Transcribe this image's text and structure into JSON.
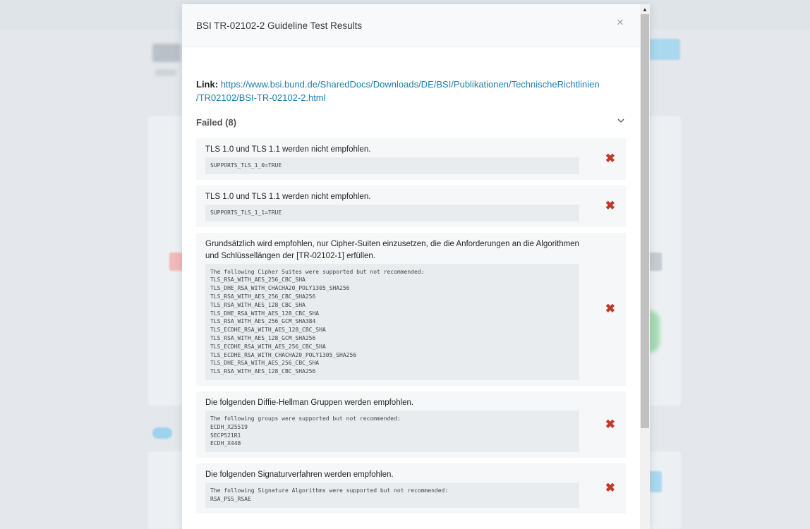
{
  "modal": {
    "title": "BSI TR-02102-2 Guideline Test Results",
    "close": "×",
    "link_label": "Link:",
    "link_url": "https://www.bsi.bund.de/SharedDocs/Downloads/DE/BSI/Publikationen/TechnischeRichtlinien/TR02102/BSI-TR-02102-2.html",
    "link_line1": "https://www.bsi.bund.de/SharedDocs/Downloads/DE/BSI/Publikationen/TechnischeRichtlinien",
    "link_line2": "/TR02102/BSI-TR-02102-2.html"
  },
  "failed_section": {
    "label": "Failed (8)",
    "rows": [
      {
        "text": "TLS 1.0 und TLS 1.1 werden nicht empfohlen.",
        "code": "SUPPORTS_TLS_1_0=TRUE"
      },
      {
        "text": "TLS 1.0 und TLS 1.1 werden nicht empfohlen.",
        "code": "SUPPORTS_TLS_1_1=TRUE"
      },
      {
        "text": "Grundsätzlich wird empfohlen, nur Cipher-Suiten einzusetzen, die die Anforderungen an die Algorithmen und Schlüssellängen der [TR-02102-1] erfüllen.",
        "code": "The following Cipher Suites were supported but not recommended:\nTLS_RSA_WITH_AES_256_CBC_SHA\nTLS_DHE_RSA_WITH_CHACHA20_POLY1305_SHA256\nTLS_RSA_WITH_AES_256_CBC_SHA256\nTLS_RSA_WITH_AES_128_CBC_SHA\nTLS_DHE_RSA_WITH_AES_128_CBC_SHA\nTLS_RSA_WITH_AES_256_GCM_SHA384\nTLS_ECDHE_RSA_WITH_AES_128_CBC_SHA\nTLS_RSA_WITH_AES_128_GCM_SHA256\nTLS_ECDHE_RSA_WITH_AES_256_CBC_SHA\nTLS_ECDHE_RSA_WITH_CHACHA20_POLY1305_SHA256\nTLS_DHE_RSA_WITH_AES_256_CBC_SHA\nTLS_RSA_WITH_AES_128_CBC_SHA256"
      },
      {
        "text": "Die folgenden Diffie-Hellman Gruppen werden empfohlen.",
        "code": "The following groups were supported but not recommended:\nECDH_X25519\nSECP521R1\nECDH_X448"
      },
      {
        "text": "Die folgenden Signaturverfahren werden empfohlen.",
        "code": "The following Signature Algorithms were supported but not recommended:\nRSA_PSS_RSAE"
      }
    ]
  },
  "icons": {
    "fail": "✖",
    "chevron": "chevron-down-icon"
  },
  "colors": {
    "fail_red": "#c0392b",
    "link_blue": "#1d7fb0"
  }
}
